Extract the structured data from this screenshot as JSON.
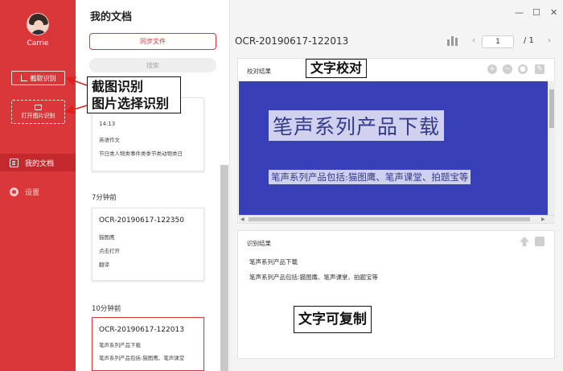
{
  "sidebar": {
    "username": "Carrie",
    "capture_label": "截取识别",
    "open_label": "打开图片识别",
    "nav": [
      {
        "label": "我的文档",
        "icon": "document-icon",
        "active": true
      },
      {
        "label": "设置",
        "icon": "gear-icon",
        "active": false
      }
    ]
  },
  "doc_list": {
    "title": "我的文档",
    "sync_label": "同步文件",
    "search_placeholder": "搜索",
    "cards": [
      {
        "time_line": "14:13",
        "lines": [
          "英语作文",
          "节日类人物类事件类季节类动物类日"
        ]
      },
      {
        "title": "OCR-20190617-122350",
        "lines": [
          "猫图鹰",
          "点击打开",
          "翻译"
        ]
      },
      {
        "title": "OCR-20190617-122013",
        "lines": [
          "笔声系列产品下载",
          "笔声系列产品包括:猫图鹰、笔声课堂"
        ]
      }
    ],
    "group_labels": [
      "7分钟前",
      "10分钟前"
    ]
  },
  "main": {
    "window_controls": {
      "minimize": "—",
      "maximize": "☐",
      "close": "✕"
    },
    "doc_title": "OCR-20190617-122013",
    "page_current": "1",
    "page_total": "/ 1",
    "pager_prev": "‹",
    "pager_next": "›",
    "proof_panel": {
      "header": "校对结果",
      "image_title": "笔声系列产品下载",
      "image_subtitle": "笔声系列产品包括:猫图鹰、笔声课堂、拍题宝等"
    },
    "result_panel": {
      "header": "识别结果",
      "lines": [
        "笔声系列产品下载",
        "笔声系列产品包括:猫图鹰、笔声课堂、拍题宝等"
      ]
    }
  },
  "annotations": {
    "capture": "截图识别",
    "image_select": "图片选择识别",
    "proofread": "文字校对",
    "copyable": "文字可复制"
  },
  "colors": {
    "accent": "#d9373a",
    "image_bg": "#3840b8"
  }
}
